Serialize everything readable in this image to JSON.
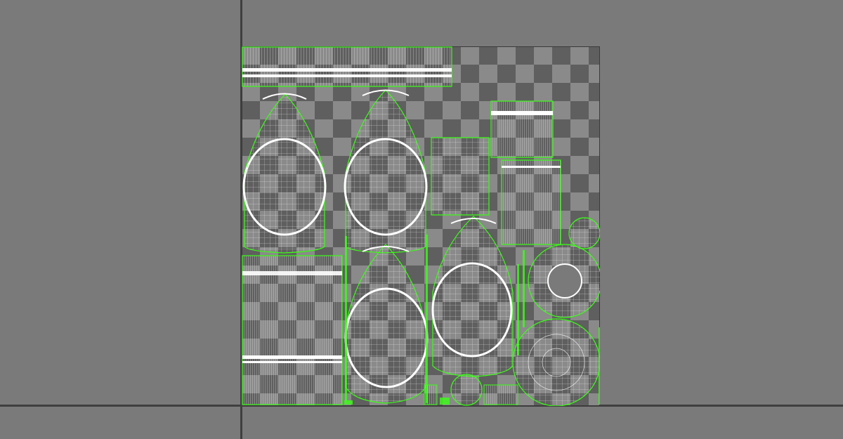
{
  "app": {
    "title": "",
    "status": ""
  },
  "viewport": {
    "background_color": "#7a7a7a",
    "axis_color": "#3f3f3f",
    "checker_dark": "#5f5f5f",
    "checker_light": "#8a8a8a",
    "wire_color": "#ffffff",
    "seam_color": "#39ff14"
  },
  "shells": [
    {
      "name": "uv-shell-strip-top"
    },
    {
      "name": "uv-shell-bottle-1"
    },
    {
      "name": "uv-shell-bottle-2"
    },
    {
      "name": "uv-shell-bottle-3"
    },
    {
      "name": "uv-shell-bottle-4"
    },
    {
      "name": "uv-shell-rect-a"
    },
    {
      "name": "uv-shell-rect-b"
    },
    {
      "name": "uv-shell-rect-c"
    },
    {
      "name": "uv-shell-rect-d"
    },
    {
      "name": "uv-shell-ring"
    },
    {
      "name": "uv-shell-disc-large"
    },
    {
      "name": "uv-shell-disc-small"
    },
    {
      "name": "uv-shell-disc-tiny"
    }
  ]
}
